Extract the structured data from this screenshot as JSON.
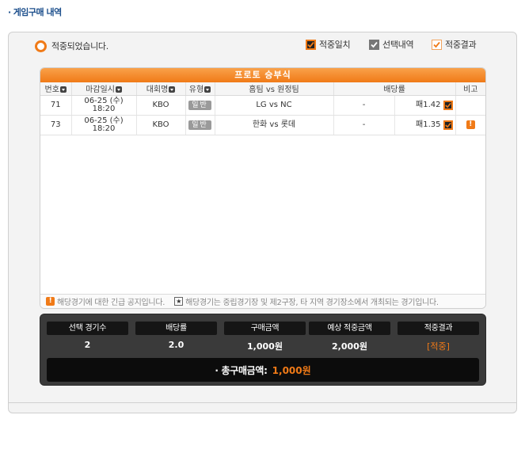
{
  "page_title": "게임구매 내역",
  "status_text": "적중되었습니다.",
  "legend": [
    {
      "label": "적중일치",
      "icon": "checkbox-checked-icon",
      "style": "dark"
    },
    {
      "label": "선택내역",
      "icon": "checkbox-selected-icon",
      "style": "gray"
    },
    {
      "label": "적중결과",
      "icon": "checkbox-result-icon",
      "style": "light"
    }
  ],
  "table": {
    "title": "프로토 승부식",
    "columns": {
      "no": "번호",
      "deadline": "마감일시",
      "league": "대회명",
      "type": "유형",
      "match": "홈팀 vs 원정팀",
      "odds": "배당률",
      "note": "비고"
    },
    "rows": [
      {
        "no": "71",
        "date": "06-25 (수)",
        "time": "18:20",
        "league": "KBO",
        "type": "일반",
        "match": "LG vs NC",
        "odd1": "-",
        "odd2": "-",
        "pick": "패",
        "pick_odds": "1.42",
        "note": ""
      },
      {
        "no": "73",
        "date": "06-25 (수)",
        "time": "18:20",
        "league": "KBO",
        "type": "일반",
        "match": "한화 vs 롯데",
        "odd1": "-",
        "odd2": "-",
        "pick": "패",
        "pick_odds": "1.35",
        "note": "!"
      }
    ],
    "footer_notice": "해당경기에 대한 긴급 공지입니다.",
    "footer_star": "해당경기는 중립경기장 및 제2구장, 타 지역 경기장소에서 개최되는 경기입니다."
  },
  "summary": {
    "headers": [
      "선택 경기수",
      "배당률",
      "구매금액",
      "예상 적중금액",
      "적중결과"
    ],
    "values": [
      "2",
      "2.0",
      "1,000원",
      "2,000원",
      "[적중]"
    ],
    "total_label": "· 총구매금액:",
    "total_value": "1,000원"
  },
  "colors": {
    "accent": "#f07a17",
    "title": "#1c4f8c",
    "summary_bg": "#3a3a3a"
  }
}
